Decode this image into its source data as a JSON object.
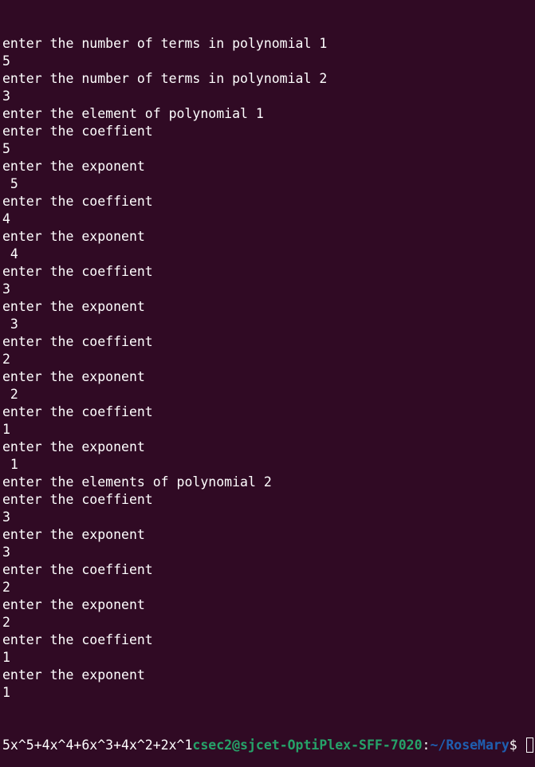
{
  "terminal": {
    "lines": [
      "enter the number of terms in polynomial 1",
      "5",
      "enter the number of terms in polynomial 2",
      "3",
      "enter the element of polynomial 1",
      "enter the coeffient",
      "5",
      "enter the exponent",
      " 5",
      "enter the coeffient",
      "4",
      "enter the exponent",
      " 4",
      "enter the coeffient",
      "3",
      "enter the exponent",
      " 3",
      "enter the coeffient",
      "2",
      "enter the exponent",
      " 2",
      "enter the coeffient",
      "1",
      "enter the exponent",
      " 1",
      "enter the elements of polynomial 2",
      "enter the coeffient",
      "3",
      "enter the exponent",
      "3",
      "enter the coeffient",
      "2",
      "enter the exponent",
      "2",
      "enter the coeffient",
      "1",
      "enter the exponent",
      "1"
    ],
    "last_line": {
      "output": "5x^5+4x^4+6x^3+4x^2+2x^1",
      "prompt_user_host": "csec2@sjcet-OptiPlex-SFF-7020",
      "prompt_separator": ":",
      "prompt_path": "~/RoseMary",
      "prompt_symbol": "$ "
    },
    "colors": {
      "background": "#300a24",
      "text": "#ffffff",
      "user_host": "#26a269",
      "path": "#1f5fb0"
    }
  }
}
